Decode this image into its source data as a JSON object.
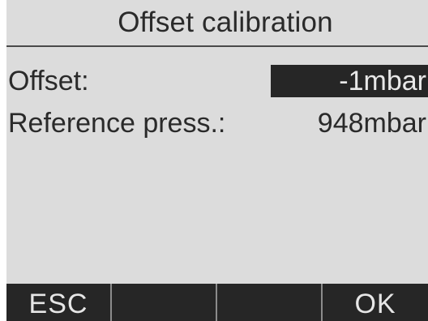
{
  "title": "Offset calibration",
  "fields": [
    {
      "label": "Offset:",
      "value": "-1mbar",
      "selected": true
    },
    {
      "label": "Reference press.:",
      "value": "948mbar",
      "selected": false
    }
  ],
  "softkeys": [
    "ESC",
    "",
    "",
    "OK"
  ],
  "colors": {
    "screen_background": "#dcdcdc",
    "text": "#2a2a2a",
    "highlight_background": "#262626",
    "highlight_text": "#e8e8e8"
  }
}
